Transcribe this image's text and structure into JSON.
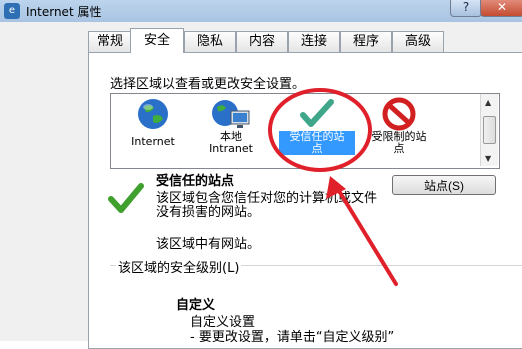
{
  "window": {
    "title": "Internet 属性",
    "help_glyph": "?",
    "close_glyph": "✕"
  },
  "tabs": [
    {
      "label": "常规"
    },
    {
      "label": "安全"
    },
    {
      "label": "隐私"
    },
    {
      "label": "内容"
    },
    {
      "label": "连接"
    },
    {
      "label": "程序"
    },
    {
      "label": "高级"
    }
  ],
  "active_tab": "安全",
  "instruction": "选择区域以查看或更改安全设置。",
  "zones": [
    {
      "label": "Internet",
      "icon": "globe-icon"
    },
    {
      "label": "本地\nIntranet",
      "icon": "intranet-icon"
    },
    {
      "label": "受信任的站\n点",
      "icon": "checkmark-icon",
      "selected": true
    },
    {
      "label": "受限制的站\n点",
      "icon": "no-entry-icon"
    }
  ],
  "selected_zone": {
    "title": "受信任的站点",
    "description": "该区域包含您信任对您的计算机或文件没有损害的网站。",
    "status": "该区域中有网站。"
  },
  "sites_button": "站点(S)",
  "security_level": {
    "group_label": "该区域的安全级别(L)",
    "level_name": "自定义",
    "line1": "自定义设置",
    "line2": "- 要更改设置，请单击“自定义级别”"
  },
  "colors": {
    "accent": "#3399ff",
    "annotation": "#e0202a",
    "check": "#3fa02e"
  }
}
